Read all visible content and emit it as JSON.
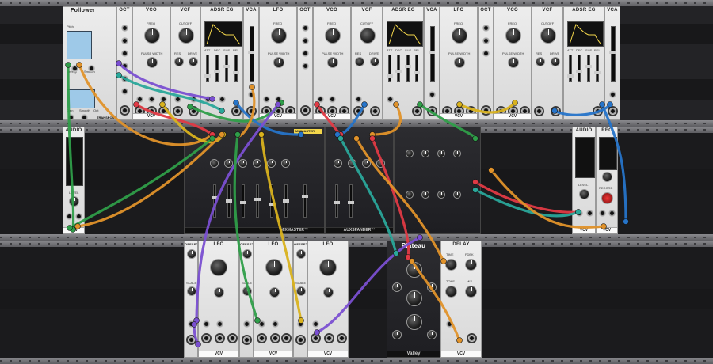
{
  "app": {
    "accent": "#f3d64b"
  },
  "rack": {
    "top_row": [
      {
        "name": "follower",
        "title": "Follower",
        "labels": {
          "pitch": "Pitch",
          "lin_exp": "Lin/exp",
          "smooth": "Smooth",
          "gain": "Gain",
          "out": "Out",
          "transpose": "TRANSPOSE"
        }
      },
      {
        "name": "oct",
        "title": "OCT"
      },
      {
        "name": "vco",
        "title": "VCO",
        "labels": {
          "freq": "FREQ",
          "pw": "PULSE WIDTH"
        }
      },
      {
        "name": "vcf",
        "title": "VCF",
        "labels": {
          "cutoff": "CUTOFF",
          "res": "RES",
          "drive": "DRIVE"
        }
      },
      {
        "name": "adsr",
        "title": "ADSR EG",
        "labels": {
          "att": "ATT",
          "dec": "DEC",
          "sus": "SUS",
          "rel": "REL"
        }
      },
      {
        "name": "vca",
        "title": "VCA"
      },
      {
        "name": "lfo",
        "title": "LFO",
        "labels": {
          "freq": "FREQ",
          "pw": "PULSE WIDTH"
        }
      },
      {
        "name": "oct2",
        "title": "OCT"
      },
      {
        "name": "vco2",
        "title": "VCO",
        "labels": {
          "freq": "FREQ",
          "pw": "PULSE WIDTH"
        }
      },
      {
        "name": "vcf2",
        "title": "VCF",
        "labels": {
          "cutoff": "CUTOFF",
          "res": "RES",
          "drive": "DRIVE"
        }
      },
      {
        "name": "adsr2",
        "title": "ADSR EG",
        "labels": {
          "att": "ATT",
          "dec": "DEC",
          "sus": "SUS",
          "rel": "REL"
        }
      },
      {
        "name": "vca2",
        "title": "VCA"
      },
      {
        "name": "lfo2",
        "title": "LFO",
        "labels": {
          "freq": "FREQ",
          "pw": "PULSE WIDTH"
        }
      },
      {
        "name": "oct3",
        "title": "OCT"
      },
      {
        "name": "vco3",
        "title": "VCO",
        "labels": {
          "freq": "FREQ",
          "pw": "PULSE WIDTH"
        }
      },
      {
        "name": "vcf3",
        "title": "VCF",
        "labels": {
          "cutoff": "CUTOFF",
          "res": "RES",
          "drive": "DRIVE"
        }
      },
      {
        "name": "adsr3",
        "title": "ADSR EG",
        "labels": {
          "att": "ATT",
          "dec": "DEC",
          "sus": "SUS",
          "rel": "REL"
        }
      },
      {
        "name": "vca3",
        "title": "VCA"
      }
    ],
    "brand": "VCV",
    "mid_row": {
      "audio_left": {
        "title": "AUDIO",
        "level": "LEVEL"
      },
      "mixmaster": {
        "title": "MIXMASTER",
        "brand": "MIXMASTER™"
      },
      "auxspander": {
        "title": "AUXSPANDER",
        "brand": "AUXSPANDER™"
      },
      "audio_right": {
        "title": "AUDIO",
        "level": "LEVEL"
      },
      "rec": {
        "title": "REC",
        "record": "RECORD"
      }
    },
    "bottom_row": {
      "offset": "OFFSET",
      "scale": "SCALE",
      "lfo_title": "LFO",
      "plateau": {
        "title": "Plateau",
        "brand": "Valley"
      },
      "delay": {
        "title": "DELAY",
        "labels": {
          "time": "TIME",
          "fdbk": "FDBK",
          "tone": "TONE",
          "mix": "MIX"
        }
      }
    }
  }
}
